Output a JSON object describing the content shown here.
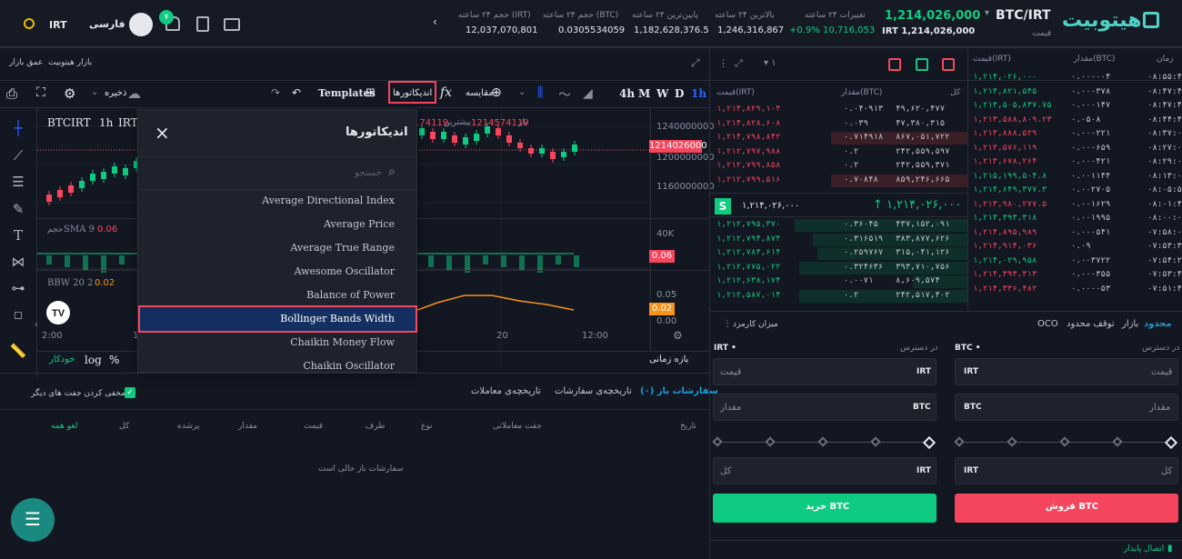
{
  "colors": {
    "bg": "#131722",
    "green": "#0ecb81",
    "red": "#f6465d",
    "accent": "#1d9bd8",
    "orange": "#f7931a"
  },
  "header": {
    "logo": "هیتوبیت",
    "pair": "BTC/IRT",
    "pair_sub": "قیمت",
    "price": "1,214,026,000",
    "price_irt": "IRT 1,214,026,000",
    "stats": [
      {
        "label": "تغییرات ۲۴ ساعته",
        "value": "+0.9%  10,716,053"
      },
      {
        "label": "بالاترین ۲۴ ساعته",
        "value": "1,246,316,867"
      },
      {
        "label": "پایین‌ترین ۲۴ ساعته",
        "value": "1,182,628,376.5"
      },
      {
        "label": "حجم ۲۴ ساعته (BTC)",
        "value": "0.0305534059"
      },
      {
        "label": "حجم ۲۴ ساعته (IRT)",
        "value": "12,037,070,801"
      }
    ],
    "lang": "فارسی",
    "currency": "IRT",
    "notif_count": "۷",
    "theme_icon": "sun-icon"
  },
  "subheader": {
    "market_link": "بازار هیتوبیت",
    "depth_link": "عمق بازار"
  },
  "chart_toolbar": {
    "intervals": [
      "1h",
      "D",
      "W",
      "M",
      "4h"
    ],
    "compare": "مقایسه",
    "indicators": "اندیکاتورها",
    "templates": "Templates",
    "save": "ذخیره"
  },
  "chart": {
    "symbol": "BTCIRT",
    "interval": "1h",
    "exchange": "IRT",
    "ohlc_low": "174119",
    "ohlc_hi_label": "بیشترین",
    "ohlc_open": "1214574119",
    "ohlc_open_label": "باز",
    "price_label": "1214026000",
    "ticks": [
      "1240000000",
      "1200000000",
      "1160000000"
    ],
    "vol_label": "حجم",
    "sma": "SMA 9",
    "sma_val": "0.06",
    "vol_tick": "40K",
    "vol_badge": "0.06",
    "bbw": "BBW 20 2",
    "bbw_val": "0.02",
    "bbw_ticks": [
      "0.05",
      "0.00"
    ],
    "bbw_badge": "0.02",
    "time_ticks": [
      "2:00",
      "1",
      "20",
      "12:00"
    ],
    "bottom": {
      "auto": "خودکار",
      "log": "log",
      "pct": "%",
      "range": "بازه زمانی"
    }
  },
  "indicator_modal": {
    "title": "اندیکاتورها",
    "search_placeholder": "جستجو",
    "items": [
      "Average Directional Index",
      "Average Price",
      "Average True Range",
      "Awesome Oscillator",
      "Balance of Power",
      "Bollinger Bands Width",
      "Chaikin Money Flow",
      "Chaikin Oscillator"
    ],
    "selected": "Bollinger Bands Width"
  },
  "orderbook": {
    "headers": [
      "قیمت(IRT)",
      "مقدار(BTC)",
      "کل"
    ],
    "asks": [
      [
        "۱,۲۱۴,۸۲۹,۱۰۴",
        "۰.۰۴۰۹۱۳",
        "۴۹,۶۲۰,۴۷۷"
      ],
      [
        "۱,۲۱۴,۸۲۸,۶۰۸",
        "۰.۰۳۹",
        "۴۷,۳۸۰,۳۱۵"
      ],
      [
        "۱,۲۱۴,۷۹۸,۸۴۲",
        "۰.۷۱۴۹۱۸",
        "۸۶۷,۰۵۱,۷۲۲"
      ],
      [
        "۱,۲۱۲,۷۹۷,۹۸۸",
        "۰.۲",
        "۲۴۲,۵۵۹,۵۹۷"
      ],
      [
        "۱,۲۱۲,۷۹۹,۸۵۸",
        "۰.۲",
        "۲۴۲,۵۵۹,۳۷۱"
      ],
      [
        "۱,۲۱۲,۷۹۹,۵۱۶",
        "۰.۷۰۸۴۸",
        "۸۵۹,۲۴۶,۶۶۵"
      ]
    ],
    "mid_price": "۱,۲۱۴,۰۲۶,۰۰۰",
    "mid_price2": "۱,۲۱۴,۰۲۶,۰۰۰",
    "mid_badge": "S",
    "bids": [
      [
        "۱,۲۱۲,۷۹۵,۳۷۰",
        "۰.۳۶۰۴۵",
        "۴۳۷,۱۵۲,۰۹۱"
      ],
      [
        "۱,۲۱۲,۷۹۴,۸۷۴",
        "۰.۳۱۶۵۱۹",
        "۳۸۳,۸۷۷,۶۲۶"
      ],
      [
        "۱,۲۱۲,۷۸۴,۶۱۴",
        "۰.۲۵۹۷۶۷",
        "۳۱۵,۰۴۱,۱۲۶"
      ],
      [
        "۱,۲۱۲,۷۷۵,۰۲۲",
        "۰.۳۲۴۶۳۶",
        "۳۹۳,۷۱۰,۷۵۶"
      ],
      [
        "۱,۲۱۲,۶۳۸,۱۷۴",
        "۰.۰۰۷۱",
        "۸,۶۰۹,۵۷۴"
      ],
      [
        "۱,۲۱۲,۵۸۷,۰۱۴",
        "۰.۲",
        "۲۴۲,۵۱۷,۴۰۲"
      ]
    ]
  },
  "trades": {
    "headers": [
      "زمان",
      "مقدار(BTC)",
      "قیمت(IRT)"
    ],
    "rows": [
      [
        "۰۸:۵۵:۴۹",
        "۰.۰۰۰۰۰۴",
        "۱,۲۱۴,۰۲۶,۰۰۰",
        "g"
      ],
      [
        "۰۸:۴۷:۴۷",
        "۰.۰۰۰۳۷۸",
        "۱,۲۱۳,۸۲۱,۵۴۵",
        "g"
      ],
      [
        "۰۸:۴۷:۴۶",
        "۰.۰۰۰۱۴۷",
        "۱,۲۱۳,۵۰۵,۸۳۷.۷۵",
        "g"
      ],
      [
        "۰۸:۴۴:۴۴",
        "۰.۰۵۰۸",
        "۱,۲۱۳,۵۸۸,۸۰۹.۲۳",
        "r"
      ],
      [
        "۰۸:۳۷:۰۴",
        "۰.۰۰۰۲۲۱",
        "۱,۲۱۳,۸۸۸,۵۲۹",
        "r"
      ],
      [
        "۰۸:۲۷:۰۹",
        "۰.۰۰۰۶۵۹",
        "۱,۲۱۳,۵۷۶,۱۱۹",
        "r"
      ],
      [
        "۰۸:۲۹:۰۸",
        "۰.۰۰۰۴۲۱",
        "۱,۲۱۳,۶۷۸,۲۶۴",
        "r"
      ],
      [
        "۰۸:۱۳:۰۱",
        "۰.۰۰۱۱۴۴",
        "۱,۲۱۵,۱۹۹,۵۰۴.۸",
        "g"
      ],
      [
        "۰۸:۰۵:۵۶",
        "۰.۰۰۲۷۰۵",
        "۱,۲۱۴,۶۴۹,۳۷۷.۳",
        "g"
      ],
      [
        "۰۸:۰۱:۴۵",
        "۰.۰۰۱۶۲۹",
        "۱,۲۱۳,۹۸۰,۲۷۷.۵",
        "r"
      ],
      [
        "۰۸:۰۰:۰۴",
        "۰.۰۰۱۹۹۵",
        "۱,۲۱۳,۳۹۳,۳۱۸",
        "g"
      ],
      [
        "۰۷:۵۸:۰۵",
        "۰.۰۰۰۵۴۱",
        "۱,۲۱۴,۸۹۵,۹۸۹",
        "r"
      ],
      [
        "۰۷:۵۳:۳۷",
        "۰.۰۹",
        "۱,۲۱۴,۹۱۴,۰۳۶",
        "r"
      ],
      [
        "۰۷:۵۴:۲۵",
        "۰.۰۰۳۷۲۲",
        "۱,۲۱۴,۰۲۹,۹۵۸",
        "g"
      ],
      [
        "۰۷:۵۳:۴۵",
        "۰.۰۰۰۳۵۵",
        "۱,۲۱۴,۳۹۳,۳۱۳",
        "r"
      ],
      [
        "۰۷:۵۱:۴۵",
        "۰.۰۰۰۰۵۳",
        "۱,۲۱۴,۳۳۶,۴۸۲",
        "r"
      ]
    ]
  },
  "order_form": {
    "tabs": [
      "محدود",
      "بازار",
      "توقف محدود",
      "OCO"
    ],
    "fee": "میزان کارمزد",
    "buy": {
      "title": "در دسترس",
      "asset": "IRT",
      "price_ph": "قیمت",
      "price_unit": "IRT",
      "amount_ph": "مقدار",
      "amount_unit": "BTC",
      "total_ph": "کل",
      "total_unit": "IRT",
      "button": "خرید BTC"
    },
    "sell": {
      "title": "در دسترس",
      "asset": "BTC",
      "price_ph": "قیمت",
      "price_unit": "IRT",
      "amount_ph": "مقدار",
      "amount_unit": "BTC",
      "total_ph": "کل",
      "total_unit": "IRT",
      "button": "فروش BTC"
    }
  },
  "orders": {
    "tabs": [
      "سفارشات باز (۰)",
      "تاریخچه‌ی سفارشات",
      "تاریخچه‌ی معاملات"
    ],
    "hide_pairs": "مخفی کردن جفت های دیگر",
    "columns": [
      "تاریخ",
      "جفت معاملاتی",
      "نوع",
      "طرف",
      "قیمت",
      "مقدار",
      "پرشده",
      "کل"
    ],
    "cancel_all": "لغو همه",
    "empty": "سفارشات باز خالی است"
  },
  "footer": {
    "status": "اتصال پایدار"
  }
}
